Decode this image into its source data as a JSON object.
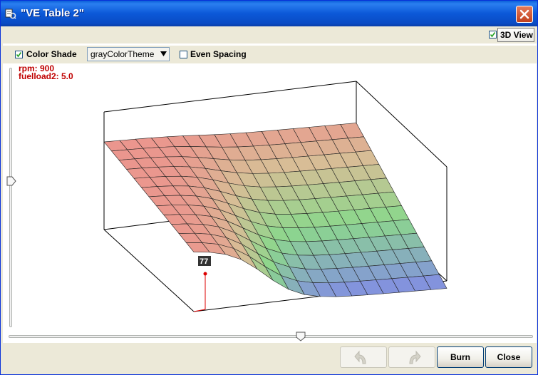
{
  "window": {
    "title": "\"VE Table 2\""
  },
  "toolbar": {
    "view_3d": {
      "label": "3D View",
      "checked": true
    },
    "color_shade": {
      "label": "Color Shade",
      "checked": true
    },
    "theme_select": {
      "value": "grayColorTheme"
    },
    "even_spacing": {
      "label": "Even Spacing",
      "checked": false
    }
  },
  "cursor_info": {
    "rpm": "rpm: 900",
    "load": "fuelload2: 5.0"
  },
  "selected_cell": {
    "value": "77"
  },
  "footer": {
    "burn_label": "Burn",
    "close_label": "Close"
  },
  "icons": {
    "undo": "undo-icon",
    "redo": "redo-icon",
    "close": "close-x-icon",
    "app": "app-icon"
  },
  "colors": {
    "info_text": "#c00000",
    "titlebar": "#0a58d8"
  }
}
